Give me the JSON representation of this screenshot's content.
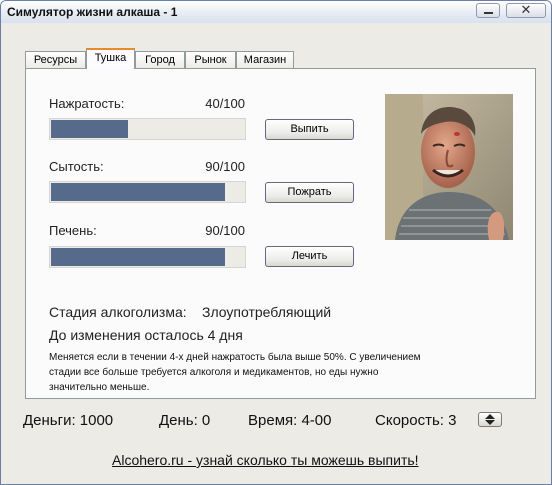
{
  "window": {
    "title": "Симулятор жизни алкаша - 1",
    "close_glyph": "✕"
  },
  "tabs": [
    {
      "label": "Ресурсы",
      "active": false
    },
    {
      "label": "Тушка",
      "active": true
    },
    {
      "label": "Город",
      "active": false
    },
    {
      "label": "Рынок",
      "active": false
    },
    {
      "label": "Магазин",
      "active": false
    }
  ],
  "stats": [
    {
      "label": "Нажратость:",
      "value_text": "40/100",
      "fraction": 0.4,
      "button": "Выпить"
    },
    {
      "label": "Сытость:",
      "value_text": "90/100",
      "fraction": 0.9,
      "button": "Пожрать"
    },
    {
      "label": "Печень:",
      "value_text": "90/100",
      "fraction": 0.9,
      "button": "Лечить"
    }
  ],
  "colors": {
    "bar_fill": "#566a8c",
    "tab_accent": "#e68b2c"
  },
  "alcoholism": {
    "stage_label": "Стадия алкоголизма:",
    "stage_value": "Злоупотребляющий",
    "remaining": "До изменения осталось 4 дня",
    "note": "Меняется если в течении 4-х дней нажратость была выше 50%. С увеличением стадии все больше требуется алкоголя и медикаментов, но еды нужно значительно меньше."
  },
  "status_bar": {
    "money": "Деньги: 1000",
    "day": "День: 0",
    "time": "Время: 4-00",
    "speed": "Скорость: 3"
  },
  "footer_link": "Alcohero.ru - узнай сколько ты можешь выпить!"
}
